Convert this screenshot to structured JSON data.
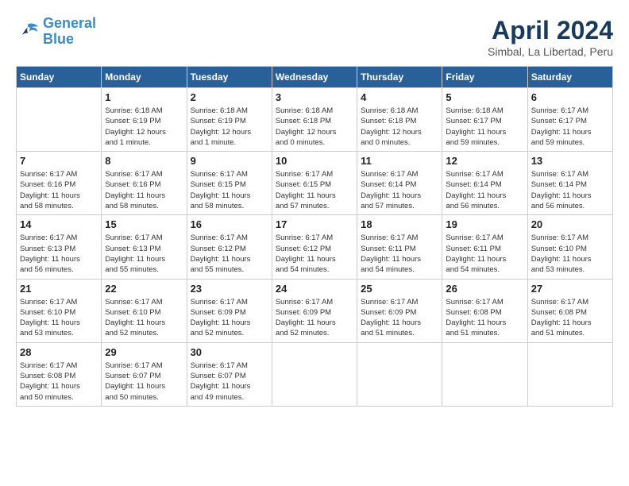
{
  "logo": {
    "line1": "General",
    "line2": "Blue"
  },
  "title": "April 2024",
  "location": "Simbal, La Libertad, Peru",
  "days_of_week": [
    "Sunday",
    "Monday",
    "Tuesday",
    "Wednesday",
    "Thursday",
    "Friday",
    "Saturday"
  ],
  "weeks": [
    [
      {
        "day": "",
        "info": ""
      },
      {
        "day": "1",
        "info": "Sunrise: 6:18 AM\nSunset: 6:19 PM\nDaylight: 12 hours\nand 1 minute."
      },
      {
        "day": "2",
        "info": "Sunrise: 6:18 AM\nSunset: 6:19 PM\nDaylight: 12 hours\nand 1 minute."
      },
      {
        "day": "3",
        "info": "Sunrise: 6:18 AM\nSunset: 6:18 PM\nDaylight: 12 hours\nand 0 minutes."
      },
      {
        "day": "4",
        "info": "Sunrise: 6:18 AM\nSunset: 6:18 PM\nDaylight: 12 hours\nand 0 minutes."
      },
      {
        "day": "5",
        "info": "Sunrise: 6:18 AM\nSunset: 6:17 PM\nDaylight: 11 hours\nand 59 minutes."
      },
      {
        "day": "6",
        "info": "Sunrise: 6:17 AM\nSunset: 6:17 PM\nDaylight: 11 hours\nand 59 minutes."
      }
    ],
    [
      {
        "day": "7",
        "info": "Sunrise: 6:17 AM\nSunset: 6:16 PM\nDaylight: 11 hours\nand 58 minutes."
      },
      {
        "day": "8",
        "info": "Sunrise: 6:17 AM\nSunset: 6:16 PM\nDaylight: 11 hours\nand 58 minutes."
      },
      {
        "day": "9",
        "info": "Sunrise: 6:17 AM\nSunset: 6:15 PM\nDaylight: 11 hours\nand 58 minutes."
      },
      {
        "day": "10",
        "info": "Sunrise: 6:17 AM\nSunset: 6:15 PM\nDaylight: 11 hours\nand 57 minutes."
      },
      {
        "day": "11",
        "info": "Sunrise: 6:17 AM\nSunset: 6:14 PM\nDaylight: 11 hours\nand 57 minutes."
      },
      {
        "day": "12",
        "info": "Sunrise: 6:17 AM\nSunset: 6:14 PM\nDaylight: 11 hours\nand 56 minutes."
      },
      {
        "day": "13",
        "info": "Sunrise: 6:17 AM\nSunset: 6:14 PM\nDaylight: 11 hours\nand 56 minutes."
      }
    ],
    [
      {
        "day": "14",
        "info": "Sunrise: 6:17 AM\nSunset: 6:13 PM\nDaylight: 11 hours\nand 56 minutes."
      },
      {
        "day": "15",
        "info": "Sunrise: 6:17 AM\nSunset: 6:13 PM\nDaylight: 11 hours\nand 55 minutes."
      },
      {
        "day": "16",
        "info": "Sunrise: 6:17 AM\nSunset: 6:12 PM\nDaylight: 11 hours\nand 55 minutes."
      },
      {
        "day": "17",
        "info": "Sunrise: 6:17 AM\nSunset: 6:12 PM\nDaylight: 11 hours\nand 54 minutes."
      },
      {
        "day": "18",
        "info": "Sunrise: 6:17 AM\nSunset: 6:11 PM\nDaylight: 11 hours\nand 54 minutes."
      },
      {
        "day": "19",
        "info": "Sunrise: 6:17 AM\nSunset: 6:11 PM\nDaylight: 11 hours\nand 54 minutes."
      },
      {
        "day": "20",
        "info": "Sunrise: 6:17 AM\nSunset: 6:10 PM\nDaylight: 11 hours\nand 53 minutes."
      }
    ],
    [
      {
        "day": "21",
        "info": "Sunrise: 6:17 AM\nSunset: 6:10 PM\nDaylight: 11 hours\nand 53 minutes."
      },
      {
        "day": "22",
        "info": "Sunrise: 6:17 AM\nSunset: 6:10 PM\nDaylight: 11 hours\nand 52 minutes."
      },
      {
        "day": "23",
        "info": "Sunrise: 6:17 AM\nSunset: 6:09 PM\nDaylight: 11 hours\nand 52 minutes."
      },
      {
        "day": "24",
        "info": "Sunrise: 6:17 AM\nSunset: 6:09 PM\nDaylight: 11 hours\nand 52 minutes."
      },
      {
        "day": "25",
        "info": "Sunrise: 6:17 AM\nSunset: 6:09 PM\nDaylight: 11 hours\nand 51 minutes."
      },
      {
        "day": "26",
        "info": "Sunrise: 6:17 AM\nSunset: 6:08 PM\nDaylight: 11 hours\nand 51 minutes."
      },
      {
        "day": "27",
        "info": "Sunrise: 6:17 AM\nSunset: 6:08 PM\nDaylight: 11 hours\nand 51 minutes."
      }
    ],
    [
      {
        "day": "28",
        "info": "Sunrise: 6:17 AM\nSunset: 6:08 PM\nDaylight: 11 hours\nand 50 minutes."
      },
      {
        "day": "29",
        "info": "Sunrise: 6:17 AM\nSunset: 6:07 PM\nDaylight: 11 hours\nand 50 minutes."
      },
      {
        "day": "30",
        "info": "Sunrise: 6:17 AM\nSunset: 6:07 PM\nDaylight: 11 hours\nand 49 minutes."
      },
      {
        "day": "",
        "info": ""
      },
      {
        "day": "",
        "info": ""
      },
      {
        "day": "",
        "info": ""
      },
      {
        "day": "",
        "info": ""
      }
    ]
  ]
}
